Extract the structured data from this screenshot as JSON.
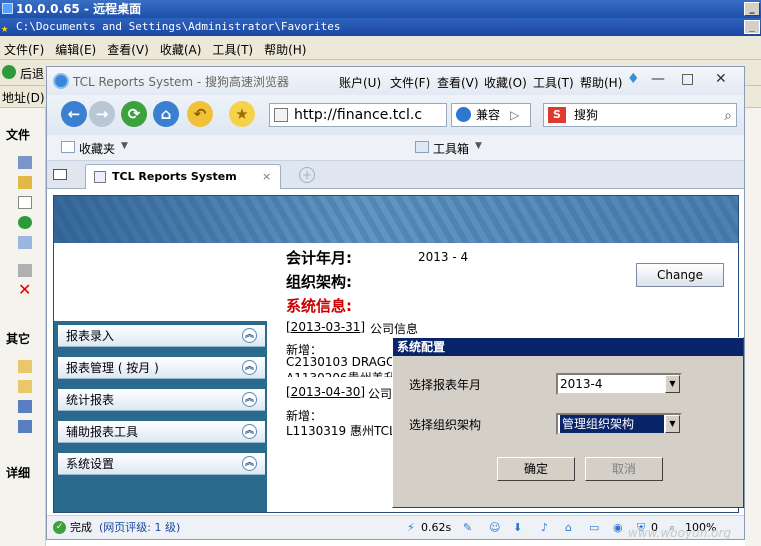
{
  "remote_desktop": {
    "title": "10.0.0.65 - 远程桌面"
  },
  "explorer": {
    "title": "C:\\Documents and Settings\\Administrator\\Favorites",
    "menu": [
      "文件(F)",
      "编辑(E)",
      "查看(V)",
      "收藏(A)",
      "工具(T)",
      "帮助(H)"
    ],
    "back_label": "后退",
    "address_label": "地址(D)",
    "groups": {
      "file": "文件",
      "other": "其它",
      "detail": "详细"
    }
  },
  "browser": {
    "title": "TCL Reports System - 搜狗高速浏览器",
    "menu": [
      "账户(U)",
      "文件(F)",
      "查看(V)",
      "收藏(O)",
      "工具(T)",
      "帮助(H)"
    ],
    "url": "http://finance.tcl.c",
    "compat_label": "兼容",
    "search_placeholder": "搜狗",
    "favorites_label": "收藏夹",
    "tools_label": "工具箱",
    "tab_title": "TCL Reports System",
    "status": {
      "done": "完成",
      "rating": "(网页评级: 1 级)",
      "time": "0.62s",
      "count": "0",
      "zoom": "100%"
    }
  },
  "page": {
    "fields": [
      {
        "label": "会计年月:",
        "value": "2013 - 4",
        "color": "#000000"
      },
      {
        "label": "组织架构:",
        "value": "",
        "color": "#000000"
      },
      {
        "label": "系统信息:",
        "value": "",
        "color": "#cc0000"
      }
    ],
    "change_button": "Change",
    "left_menu": [
      "报表录入",
      "报表管理 ( 按月 )",
      "统计报表",
      "辅助报表工具",
      "系统设置"
    ],
    "messages": {
      "date1": "[2013-03-31]",
      "title1": "公司信息",
      "new1": "新增：",
      "line1a": "C2130103 DRAGO",
      "line1b": "A1130206贵州美升",
      "date2": "[2013-04-30]",
      "title2": "公司",
      "new2": "新增：",
      "line2a": "L1130319 惠州TCL"
    }
  },
  "dialog": {
    "title": "系统配置",
    "year_label": "选择报表年月",
    "year_value": "2013-4",
    "org_label": "选择组织架构",
    "org_value": "管理组织架构",
    "ok": "确定",
    "cancel": "取消"
  },
  "watermark": "www.wooyun.org",
  "colors": {
    "accent": "#0a246a",
    "menu_bg": "#2a6a8c",
    "alert": "#cc0000"
  }
}
